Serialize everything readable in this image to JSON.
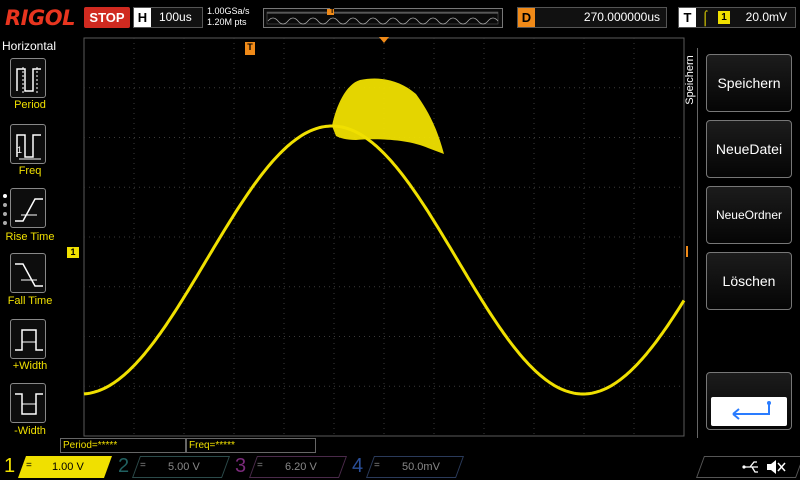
{
  "brand": "RIGOL",
  "run_state": "STOP",
  "horizontal": {
    "label": "H",
    "timebase": "100us",
    "sample_rate": "1.00GSa/s",
    "mem_points": "1.20M pts"
  },
  "memory_marker": "T",
  "delay": {
    "label": "D",
    "value": "270.000000us"
  },
  "trigger": {
    "label": "T",
    "edge_icon": "rising-edge-icon",
    "source": "1",
    "level": "20.0mV"
  },
  "left_panel": {
    "title": "Horizontal",
    "items": [
      {
        "label": "Period",
        "icon": "period-icon"
      },
      {
        "label": "Freq",
        "icon": "freq-icon"
      },
      {
        "label": "Rise Time",
        "icon": "rise-time-icon"
      },
      {
        "label": "Fall Time",
        "icon": "fall-time-icon"
      },
      {
        "label": "+Width",
        "icon": "positive-width-icon"
      },
      {
        "label": "-Width",
        "icon": "negative-width-icon"
      }
    ]
  },
  "markers": {
    "trigger_pos": "T",
    "ch1_ref": "1",
    "trig_level": "T"
  },
  "right_menu": {
    "title": "Speichern",
    "buttons": [
      "Speichern",
      "NeueDatei",
      "NeueOrdner",
      "Löschen"
    ],
    "enter_icon": "enter-icon"
  },
  "results": {
    "period": "Period=*****",
    "freq": "Freq=*****"
  },
  "channels": [
    {
      "num": "1",
      "coupling": "=",
      "scale": "1.00 V",
      "color": "#f0e000",
      "active": true
    },
    {
      "num": "2",
      "coupling": "=",
      "scale": "5.00 V",
      "color": "#00c8c8",
      "active": false
    },
    {
      "num": "3",
      "coupling": "=",
      "scale": "6.20 V",
      "color": "#e040e0",
      "active": false
    },
    {
      "num": "4",
      "coupling": "=",
      "scale": "50.0mV",
      "color": "#2a7cff",
      "active": false
    }
  ],
  "status_icons": [
    "usb-icon",
    "speaker-muted-icon"
  ],
  "colors": {
    "trace": "#f0e000",
    "accent": "#f08a18",
    "stop": "#d02a20",
    "grid": "#4a4a4a"
  }
}
